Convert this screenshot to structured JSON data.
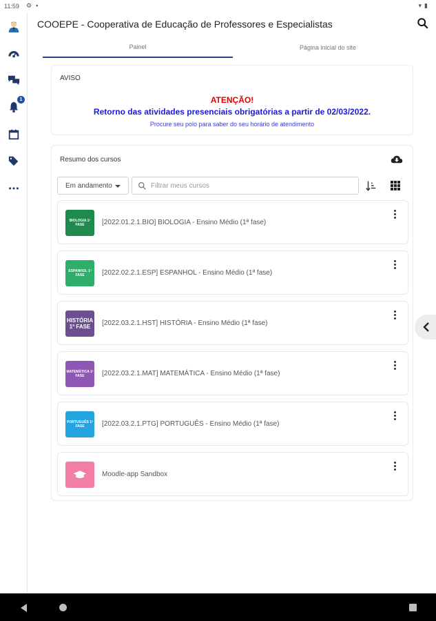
{
  "status_bar": {
    "time": "11:59",
    "icons": [
      "settings-icon",
      "sim-icon"
    ],
    "right_icons": [
      "wifi-icon",
      "battery-icon"
    ]
  },
  "sidebar": {
    "items": [
      {
        "name": "avatar"
      },
      {
        "name": "dashboard-icon"
      },
      {
        "name": "messages-icon"
      },
      {
        "name": "notifications-icon",
        "badge": "1"
      },
      {
        "name": "calendar-icon"
      },
      {
        "name": "tags-icon"
      },
      {
        "name": "more-icon"
      }
    ]
  },
  "header": {
    "title": "COOEPE - Cooperativa de Educação de Professores e Especialistas"
  },
  "tabs": [
    {
      "label": "Painel",
      "active": true
    },
    {
      "label": "Página inicial do site",
      "active": false
    }
  ],
  "notice": {
    "label": "AVISO",
    "warning": "ATENÇÃO!",
    "message": "Retorno das atividades presenciais obrigatórias a partir de 02/03/2022.",
    "sub": "Procure seu polo para saber do seu horário de atendimento"
  },
  "courses": {
    "title": "Resumo dos cursos",
    "filter": "Em andamento",
    "search_placeholder": "Filtrar meus cursos",
    "items": [
      {
        "name": "[2022.01.2.1.BIO] BIOLOGIA - Ensino Médio (1ª fase)",
        "thumb": "BIOLOGIA 1ª FASE",
        "color": "#1e8a4e"
      },
      {
        "name": "[2022.02.2.1.ESP] ESPANHOL - Ensino Médio (1ª fase)",
        "thumb": "ESPANHOL 1ª FASE",
        "color": "#2eae6a"
      },
      {
        "name": "[2022.03.2.1.HST] HISTÓRIA - Ensino Médio (1ª fase)",
        "thumb": "HISTÓRIA 1ª FASE",
        "color": "#6b4f8f"
      },
      {
        "name": "[2022.03.2.1.MAT] MATEMÁTICA - Ensino Médio (1ª fase)",
        "thumb": "MATEMÁTICA 1ª FASE",
        "color": "#8e57b3"
      },
      {
        "name": "[2022.03.2.1.PTG] PORTUGUÊS - Ensino Médio (1ª fase)",
        "thumb": "PORTUGUÊS 1ª FASE",
        "color": "#23a3e0"
      },
      {
        "name": "Moodle-app Sandbox",
        "thumb": "",
        "color": "#f17ea5"
      }
    ]
  },
  "colors": {
    "accent": "#27408b",
    "warning": "#e00000",
    "message": "#1a1ad6"
  }
}
